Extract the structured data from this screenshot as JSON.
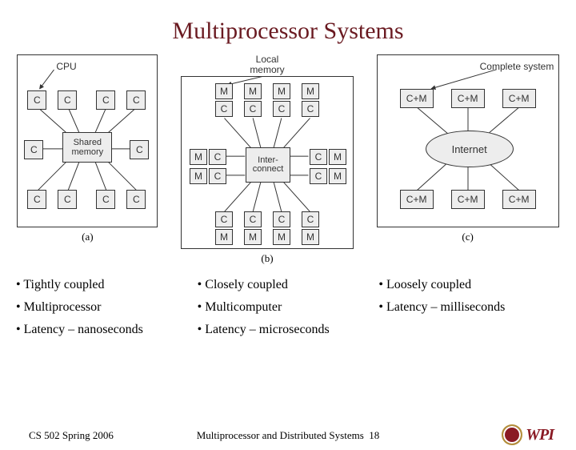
{
  "title": "Multiprocessor Systems",
  "fig": {
    "a": {
      "cpu_label": "CPU",
      "shared_memory": "Shared\nmemory",
      "cell": "C",
      "caption": "(a)"
    },
    "b": {
      "local_memory": "Local\nmemory",
      "interconnect": "Inter-\nconnect",
      "m": "M",
      "c": "C",
      "caption": "(b)"
    },
    "c": {
      "complete_system": "Complete system",
      "node": "C+M",
      "hub": "Internet",
      "caption": "(c)"
    }
  },
  "columns": {
    "a": [
      "Tightly coupled",
      "Multiprocessor",
      "Latency – nanoseconds"
    ],
    "b": [
      "Closely coupled",
      "Multicomputer",
      "Latency – microseconds"
    ],
    "c": [
      "Loosely coupled",
      "Latency – milliseconds"
    ]
  },
  "footer": {
    "left": "CS 502 Spring 2006",
    "center_prefix": "Multiprocessor and Distributed Systems",
    "page": "18",
    "logo_text": "WPI"
  }
}
